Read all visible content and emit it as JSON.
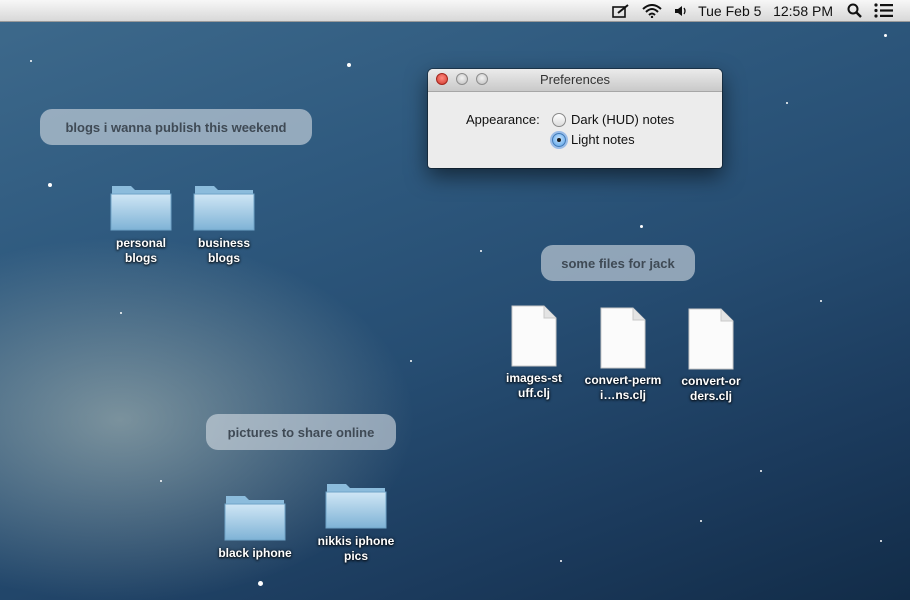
{
  "menubar": {
    "icons": [
      "notes-icon",
      "wifi-icon",
      "volume-icon",
      "spotlight-icon",
      "notification-center-icon"
    ],
    "clock": "Tue Feb 5   12:58 PM"
  },
  "preferences_window": {
    "title": "Preferences",
    "appearance_label": "Appearance:",
    "options": [
      {
        "label": "Dark (HUD) notes",
        "selected": false
      },
      {
        "label": "Light notes",
        "selected": true
      }
    ]
  },
  "groups": [
    {
      "label": "blogs i wanna publish this weekend"
    },
    {
      "label": "some files for jack"
    },
    {
      "label": "pictures to share online"
    }
  ],
  "desktop_items": [
    {
      "type": "folder",
      "name": "personal blogs"
    },
    {
      "type": "folder",
      "name": "business blogs"
    },
    {
      "type": "document",
      "name": "images-stuff.clj"
    },
    {
      "type": "document",
      "name": "convert-permi…ns.clj"
    },
    {
      "type": "document",
      "name": "convert-orders.clj"
    },
    {
      "type": "folder",
      "name": "black iphone"
    },
    {
      "type": "folder",
      "name": "nikkis iphone pics"
    }
  ],
  "colors": {
    "desktop_top": "#3e6a8c",
    "desktop_bottom": "#122c48",
    "group_label_bg": "#d2dae2",
    "radio_selected": "#5aa2e6",
    "close_button": "#d0382c"
  }
}
